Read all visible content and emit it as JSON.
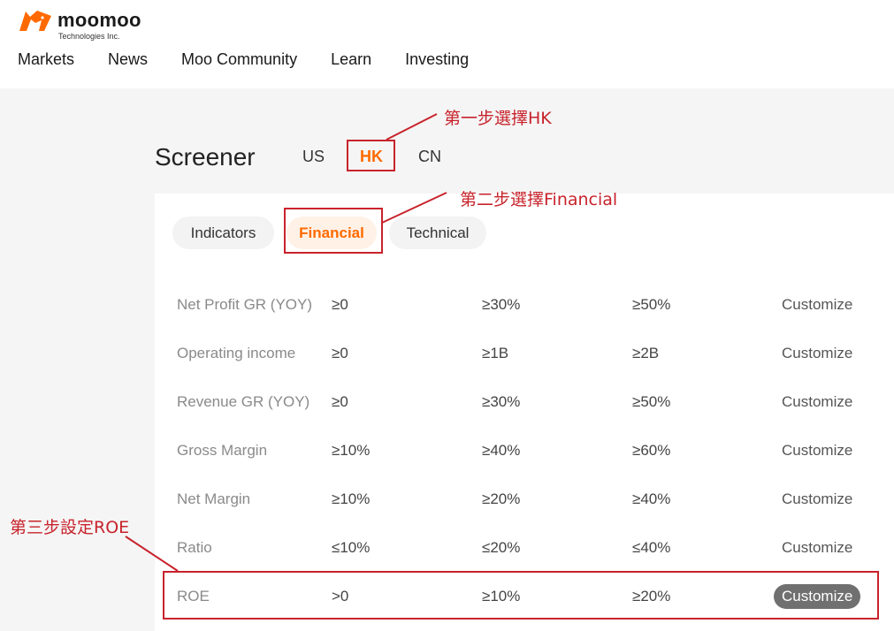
{
  "brand": {
    "name": "moomoo",
    "subtitle": "Technologies Inc.",
    "color": "#ff6a00"
  },
  "nav": {
    "items": [
      "Markets",
      "News",
      "Moo Community",
      "Learn",
      "Investing"
    ]
  },
  "screener": {
    "title": "Screener",
    "markets": [
      "US",
      "HK",
      "CN"
    ],
    "active_market": "HK",
    "categories": [
      "Indicators",
      "Financial",
      "Technical"
    ],
    "active_category": "Financial",
    "rows": [
      {
        "label": "Net Profit GR (YOY)",
        "options": [
          "≥0",
          "≥30%",
          "≥50%"
        ],
        "custom": "Customize"
      },
      {
        "label": "Operating income",
        "options": [
          "≥0",
          "≥1B",
          "≥2B"
        ],
        "custom": "Customize"
      },
      {
        "label": "Revenue GR (YOY)",
        "options": [
          "≥0",
          "≥30%",
          "≥50%"
        ],
        "custom": "Customize"
      },
      {
        "label": "Gross Margin",
        "options": [
          "≥10%",
          "≥40%",
          "≥60%"
        ],
        "custom": "Customize"
      },
      {
        "label": "Net Margin",
        "options": [
          "≥10%",
          "≥20%",
          "≥40%"
        ],
        "custom": "Customize"
      },
      {
        "label": "Ratio",
        "options": [
          "≤10%",
          "≤20%",
          "≤40%"
        ],
        "custom": "Customize"
      },
      {
        "label": "ROE",
        "options": [
          ">0",
          "≥10%",
          "≥20%"
        ],
        "custom": "Customize",
        "custom_selected": true
      }
    ]
  },
  "annotations": {
    "step1": "第一步選擇HK",
    "step2": "第二步選擇Financial",
    "step3": "第三步設定ROE",
    "color": "#c8232c"
  }
}
